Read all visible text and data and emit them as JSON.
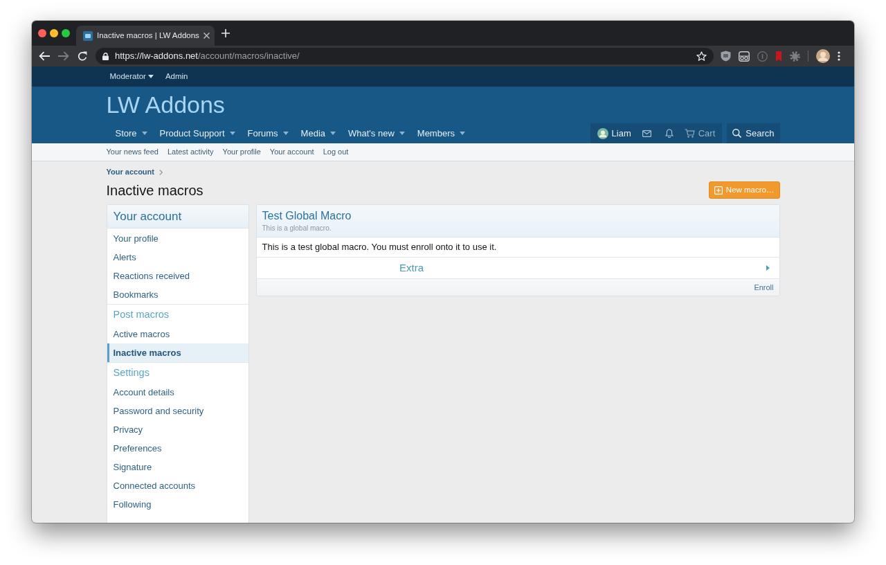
{
  "browser": {
    "tab": {
      "title": "Inactive macros | LW Addons"
    },
    "address": {
      "host": "https://lw-addons.net",
      "path": "/account/macros/inactive/"
    }
  },
  "staff_bar": [
    {
      "label": "Moderator",
      "dropdown": true
    },
    {
      "label": "Admin",
      "dropdown": false
    }
  ],
  "logo": "LW Addons",
  "nav": [
    {
      "label": "Store",
      "dropdown": true
    },
    {
      "label": "Product Support",
      "dropdown": true
    },
    {
      "label": "Forums",
      "dropdown": true
    },
    {
      "label": "Media",
      "dropdown": true
    },
    {
      "label": "What's new",
      "dropdown": true
    },
    {
      "label": "Members",
      "dropdown": true
    }
  ],
  "user_nav": {
    "username": "Liam",
    "cart": "Cart",
    "search": "Search"
  },
  "section_links": [
    "Your news feed",
    "Latest activity",
    "Your profile",
    "Your account",
    "Log out"
  ],
  "breadcrumb": [
    "Your account"
  ],
  "page_title": "Inactive macros",
  "new_button": "New macro…",
  "sidebar": {
    "title": "Your account",
    "sections": [
      {
        "items": [
          {
            "label": "Your profile",
            "selected": false
          },
          {
            "label": "Alerts",
            "selected": false
          },
          {
            "label": "Reactions received",
            "selected": false
          },
          {
            "label": "Bookmarks",
            "selected": false
          }
        ]
      },
      {
        "title": "Post macros",
        "items": [
          {
            "label": "Active macros",
            "selected": false
          },
          {
            "label": "Inactive macros",
            "selected": true
          }
        ]
      },
      {
        "title": "Settings",
        "items": [
          {
            "label": "Account details",
            "selected": false
          },
          {
            "label": "Password and security",
            "selected": false
          },
          {
            "label": "Privacy",
            "selected": false
          },
          {
            "label": "Preferences",
            "selected": false
          },
          {
            "label": "Signature",
            "selected": false
          },
          {
            "label": "Connected accounts",
            "selected": false
          },
          {
            "label": "Following",
            "selected": false
          }
        ]
      }
    ]
  },
  "macros": [
    {
      "title": "Test Global Macro",
      "subtitle": "This is a global macro.",
      "description": "This is a test global macro. You must enroll onto it to use it.",
      "extra": {
        "label": "Extra",
        "expanded": false
      },
      "action": "Enroll"
    }
  ]
}
